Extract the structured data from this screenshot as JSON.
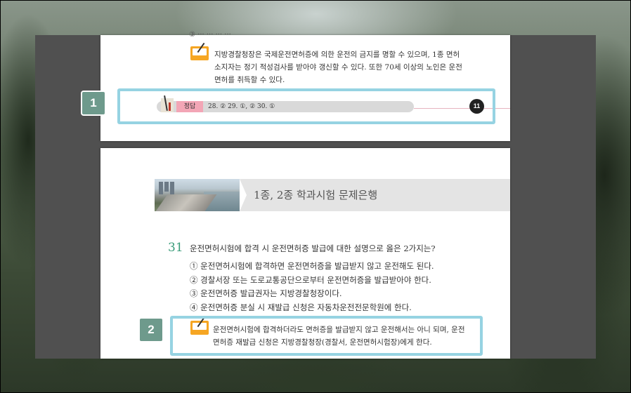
{
  "page1": {
    "top_cut_text": "③  ···  ···  ···  ···",
    "note_lines": [
      "지방경찰청장은 국제운전면허증에 의한 운전의 금지를 명할 수 있으며, 1종 면허",
      "소지자는 정기 적성검사를 받아야 갱신할 수 있다. 또한 70세 이상의 노인은 운전",
      "면허를 취득할 수 있다."
    ],
    "answer_label": "정답",
    "answers": "28. ②    29. ①, ②    30. ①",
    "page_number": "11"
  },
  "page2": {
    "banner_title": "1종, 2종 학과시험 문제은행",
    "question_number": "31",
    "question": "운전면허시험에 합격 시 운전면허증 발급에 대한 설명으로 옳은 2가지는?",
    "options": [
      "① 운전면허시험에 합격하면 운전면허증을 발급받지 않고 운전해도 된다.",
      "② 경찰서장 또는 도로교통공단으로부터 운전면허증을 발급받아야 한다.",
      "③ 운전면허증 발급권자는 지방경찰청장이다.",
      "④ 운전면허증 분실 시 재발급 신청은 자동차운전전문학원에 한다."
    ],
    "note_lines": [
      "운전면허시험에 합격하더라도 면허증을 발급받지 않고 운전해서는 아니 되며, 운전",
      "면허증 재발급 신청은 지방경찰청장(경찰서, 운전면허시험장)에게 한다."
    ]
  },
  "badges": [
    "1",
    "2"
  ],
  "colors": {
    "highlight": "#96d3e2",
    "badge": "#6e9a8c",
    "question_number": "#3a9c7a",
    "note_icon": "#f6a623",
    "answer_tag": "#f3a6b6"
  }
}
